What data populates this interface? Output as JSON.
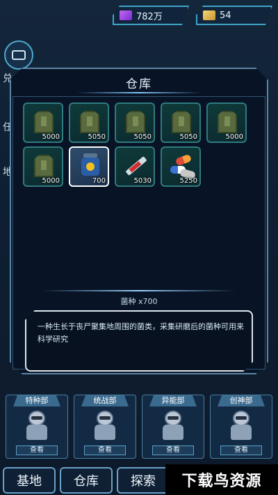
{
  "currency": {
    "gems": "782万",
    "coins": "54"
  },
  "side_labels": [
    "兑",
    "任",
    "地"
  ],
  "dialog": {
    "title": "仓库",
    "items": [
      {
        "qty": "5000",
        "icon": "vest-icon"
      },
      {
        "qty": "5050",
        "icon": "vest-icon"
      },
      {
        "qty": "5050",
        "icon": "vest-icon"
      },
      {
        "qty": "5050",
        "icon": "vest-icon"
      },
      {
        "qty": "5000",
        "icon": "vest-icon"
      },
      {
        "qty": "5000",
        "icon": "vest-icon"
      },
      {
        "qty": "700",
        "icon": "fungus-jar-icon"
      },
      {
        "qty": "5030",
        "icon": "syringe-icon"
      },
      {
        "qty": "5250",
        "icon": "pills-icon"
      }
    ],
    "selected_name": "菌种 x700",
    "description": "一种生长于丧尸聚集地周围的菌类，采集研磨后的菌种可用来科学研究"
  },
  "departments": [
    {
      "name": "特种部",
      "button": "查看"
    },
    {
      "name": "统战部",
      "button": "查看"
    },
    {
      "name": "异能部",
      "button": "查看"
    },
    {
      "name": "创神部",
      "button": "查看"
    }
  ],
  "bottom_nav": [
    "基地",
    "仓库",
    "探索"
  ],
  "watermark": "下载鸟资源"
}
